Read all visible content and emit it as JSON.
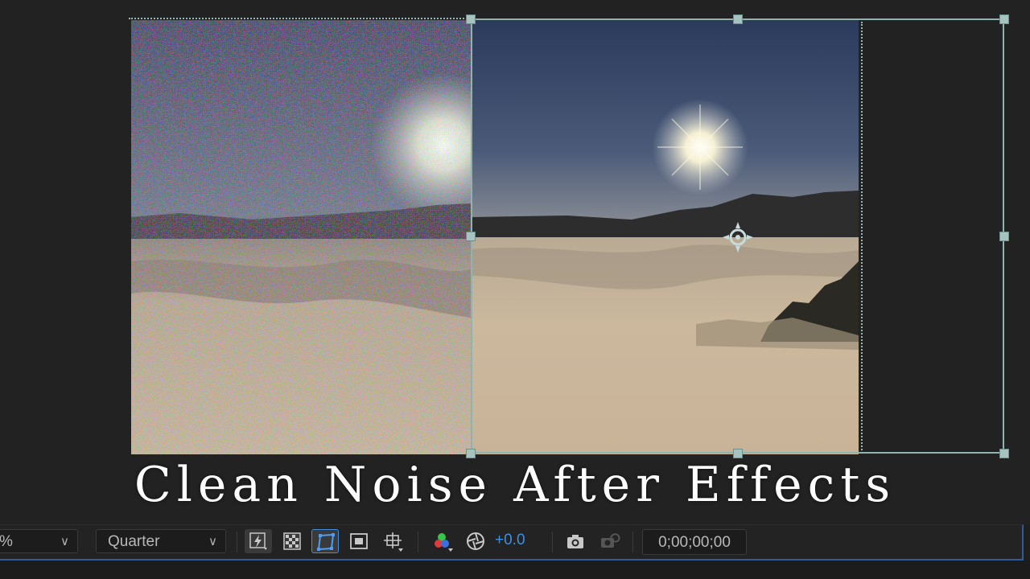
{
  "title": "Clean Noise After Effects",
  "toolbar": {
    "magnification_value": "%",
    "resolution_value": "Quarter",
    "exposure_value": "+0.0",
    "timecode": "0;00;00;00"
  },
  "colors": {
    "accent": "#3f8fe0",
    "handle": "#a7c3c0",
    "panel_border": "#2f5d9b"
  },
  "icons": {
    "fast_previews": "lightning-icon",
    "transparency_grid": "checkerboard-icon",
    "mask_visibility": "mask-path-icon",
    "region_of_interest": "region-icon",
    "grid_guides": "grid-guides-icon",
    "channels": "rgb-channels-icon",
    "reset_exposure": "exposure-icon",
    "snapshot": "camera-icon",
    "show_snapshot": "show-snapshot-icon"
  }
}
